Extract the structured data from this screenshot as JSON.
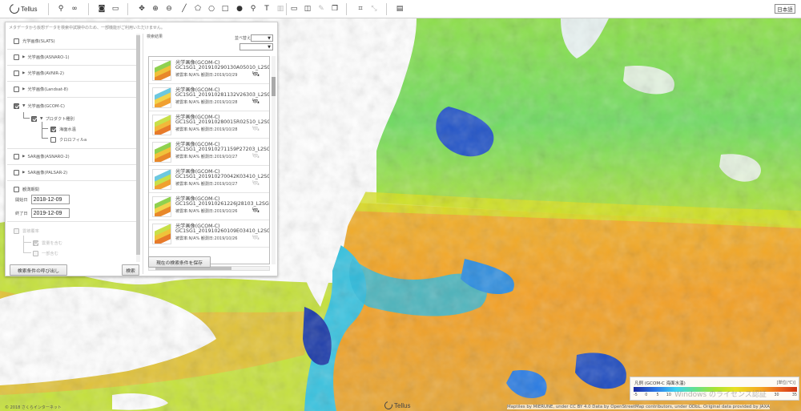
{
  "app": {
    "name": "Tellus"
  },
  "toolbar": {
    "language_button": "日本語"
  },
  "panel": {
    "notice": "メタデータから仮想データを検索中試験中のため、一部機能がご利用いただけません。",
    "categories": [
      {
        "label": "光学画像(SLATS)",
        "checked": false,
        "arrow": false
      },
      {
        "label": "光学画像(ASNARO-1)",
        "checked": false,
        "arrow": true
      },
      {
        "label": "光学画像(AVNIR-2)",
        "checked": false,
        "arrow": true
      },
      {
        "label": "光学画像(Landsat-8)",
        "checked": false,
        "arrow": true
      },
      {
        "label": "光学画像(GCOM-C)",
        "checked": true,
        "arrow": true
      },
      {
        "label": "SAR画像(ASNARO-2)",
        "checked": false,
        "arrow": true
      },
      {
        "label": "SAR画像(PALSAR-2)",
        "checked": false,
        "arrow": true
      },
      {
        "label": "観測期間",
        "checked": false,
        "arrow": false
      }
    ],
    "product_type": {
      "label": "プロダクト種別",
      "options": [
        "海面水温",
        "クロロフィルa"
      ]
    },
    "period": {
      "start_label": "開始日",
      "start_value": "2018-12-09",
      "end_label": "終了日",
      "end_value": "2019-12-09"
    },
    "cloud": {
      "label": "雲被覆率",
      "options": [
        "雲量を含む",
        "一部含む"
      ]
    },
    "load_conditions_button": "検索条件の呼び出し",
    "search_button": "検索",
    "results": {
      "title": "検索結果",
      "sort_label": "並べ替え",
      "items": [
        {
          "line1": "光学画像(GCOM-C)",
          "line2": "GC1SG1_201910290130A05010_L2SG",
          "line3": "被雲率:N/A% 観測日:2019/10/29",
          "sat_faint": false
        },
        {
          "line1": "光学画像(GCOM-C)",
          "line2": "GC1SG1_201910281132V26303_L2SG",
          "line3": "被雲率:N/A% 観測日:2019/10/28",
          "sat_faint": false
        },
        {
          "line1": "光学画像(GCOM-C)",
          "line2": "GC1SG1_201910280015R02510_L2SG",
          "line3": "被雲率:N/A% 観測日:2019/10/28",
          "sat_faint": true
        },
        {
          "line1": "光学画像(GCOM-C)",
          "line2": "GC1SG1_201910271159P27203_L2SG",
          "line3": "被雲率:N/A% 観測日:2019/10/27",
          "sat_faint": true
        },
        {
          "line1": "光学画像(GCOM-C)",
          "line2": "GC1SG1_201910270042K03410_L2SG",
          "line3": "被雲率:N/A% 観測日:2019/10/27",
          "sat_faint": true
        },
        {
          "line1": "光学画像(GCOM-C)",
          "line2": "GC1SG1_201910261226J28103_L2SG",
          "line3": "被雲率:N/A% 観測日:2019/10/26",
          "sat_faint": false
        },
        {
          "line1": "光学画像(GCOM-C)",
          "line2": "GC1SG1_201910260109E03410_L2SG",
          "line3": "被雲率:N/A% 観測日:2019/10/26",
          "sat_faint": true
        }
      ],
      "save_button": "現在の検索条件を保存"
    }
  },
  "legend": {
    "title": "凡例 (GCOM-C 海面水温)",
    "unit": "[単位(℃)]",
    "ticks": [
      "-5",
      "0",
      "5",
      "10",
      "30",
      "35"
    ],
    "tick_fractions": [
      0.0,
      0.07,
      0.14,
      0.2,
      0.86,
      0.97
    ]
  },
  "watermark": "Windows のライセンス認証",
  "copyright": "© 2018 さくらインターネット",
  "attribution": "Maptiles by MIERUNE, under CC BY 4.0 Data by OpenStreetMap contributors, under ODbL. Original data provided by JAXA"
}
